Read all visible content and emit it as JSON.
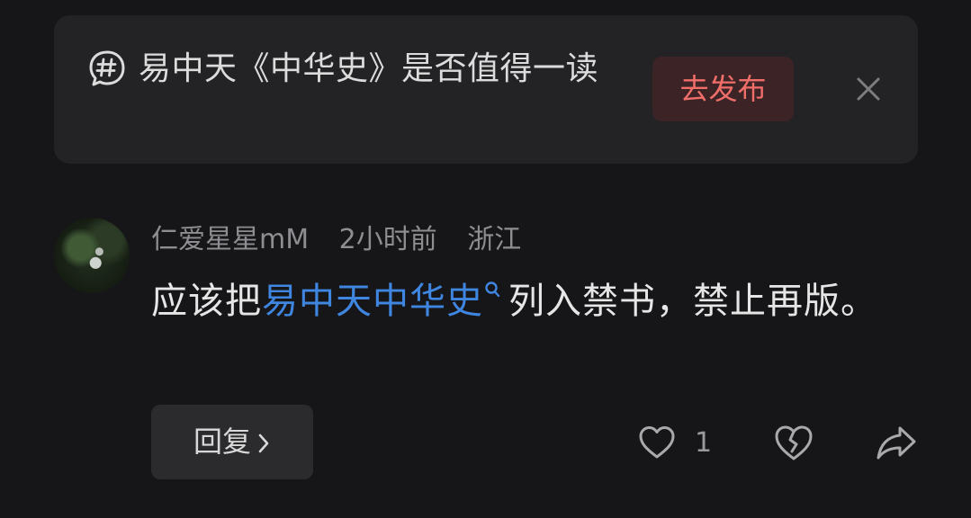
{
  "topic_card": {
    "icon": "hashtag-bubble-icon",
    "text": "易中天《中华史》是否值得一读",
    "publish_label": "去发布",
    "close_icon": "close-icon"
  },
  "comment": {
    "author": "仁爱星星mM",
    "time": "2小时前",
    "location": "浙江",
    "text_before": "应该把",
    "link_text": "易中天中华史",
    "text_after": "列入禁书，禁止再版。",
    "reply_label": "回复",
    "like_count": "1",
    "icons": {
      "like": "heart-icon",
      "dislike": "broken-heart-icon",
      "share": "share-icon"
    }
  },
  "colors": {
    "background": "#161618",
    "card": "#232326",
    "publish_text": "#f06e69",
    "link": "#3f86e0"
  }
}
